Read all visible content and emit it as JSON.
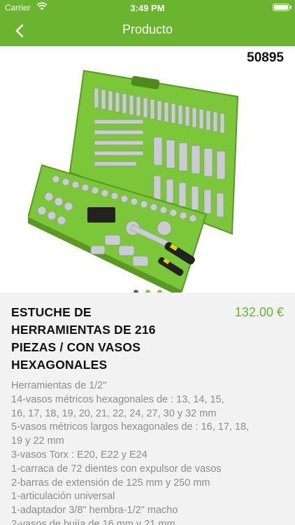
{
  "status_bar": {
    "carrier": "Carrier",
    "time": "3:49 PM",
    "battery_level": 1.0
  },
  "nav": {
    "title": "Producto",
    "back_icon": "chevron-left-icon"
  },
  "colors": {
    "brand_green": "#6ab42f",
    "dot_active": "#2e7d32",
    "dot_inactive": "#8bc34a"
  },
  "product": {
    "reference": "50895",
    "title": "ESTUCHE DE HERRAMIENTAS DE 216 PIEZAS / CON VASOS HEXAGONALES",
    "price": "132.00 €",
    "description_lines": [
      "Herramientas de 1/2\"",
      "14-vasos métricos hexagonales de : 13, 14, 15,",
      "16, 17, 18, 19, 20, 21, 22, 24, 27, 30 y 32 mm",
      "5-vasos métricos largos hexagonales de : 16, 17, 18,",
      "19 y 22 mm",
      "3-vasos Torx : E20, E22 y E24",
      "1-carraca de 72 dientes con expulsor de vasos",
      "2-barras de extensión de 125 mm y 250 mm",
      "1-articulación universal",
      "1-adaptador 3/8\" hembra-1/2\" macho",
      "2-vasos de bujía de 16 mm y 21 mm"
    ]
  },
  "gallery": {
    "page_count": 3,
    "current_page": 1
  }
}
